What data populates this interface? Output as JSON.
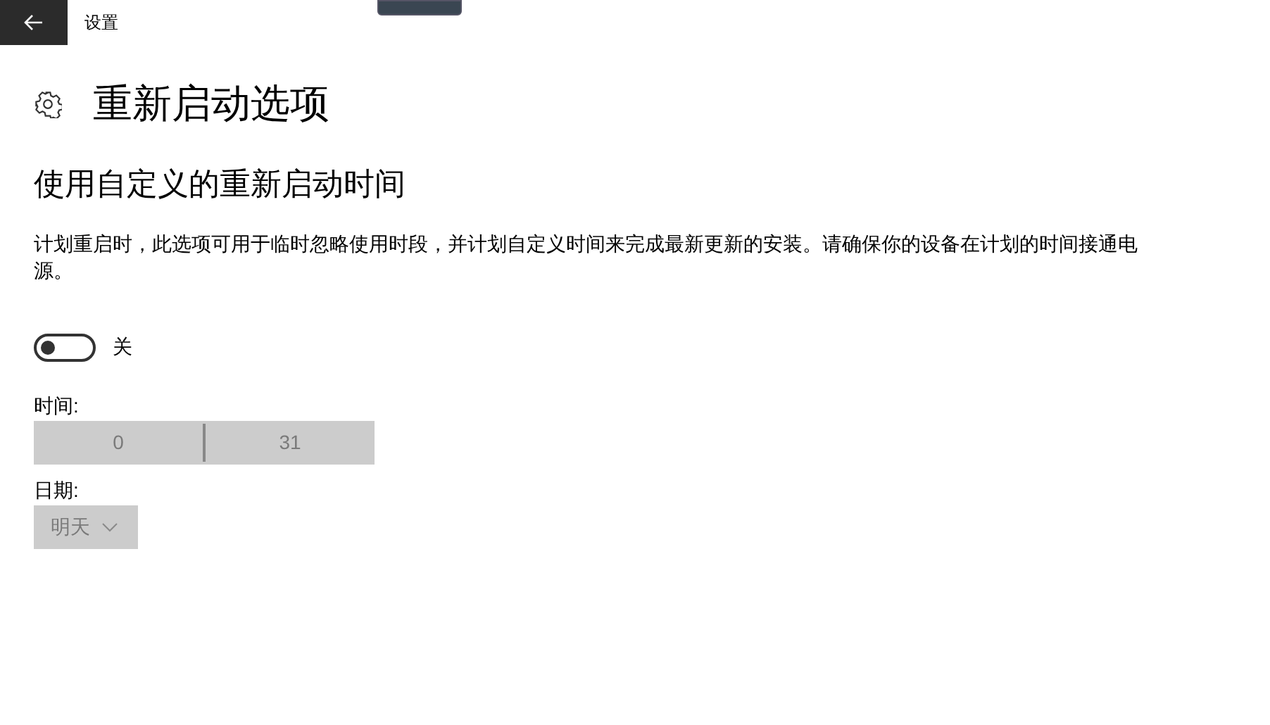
{
  "window": {
    "title": "设置"
  },
  "page": {
    "title": "重新启动选项"
  },
  "section": {
    "heading": "使用自定义的重新启动时间",
    "description": "计划重启时，此选项可用于临时忽略使用时段，并计划自定义时间来完成最新更新的安装。请确保你的设备在计划的时间接通电源。"
  },
  "toggle": {
    "on": false,
    "label": "关"
  },
  "time_picker": {
    "label": "时间:",
    "disabled": true,
    "hour": "0",
    "minute": "31"
  },
  "date_picker": {
    "label": "日期:",
    "disabled": true,
    "value": "明天"
  }
}
